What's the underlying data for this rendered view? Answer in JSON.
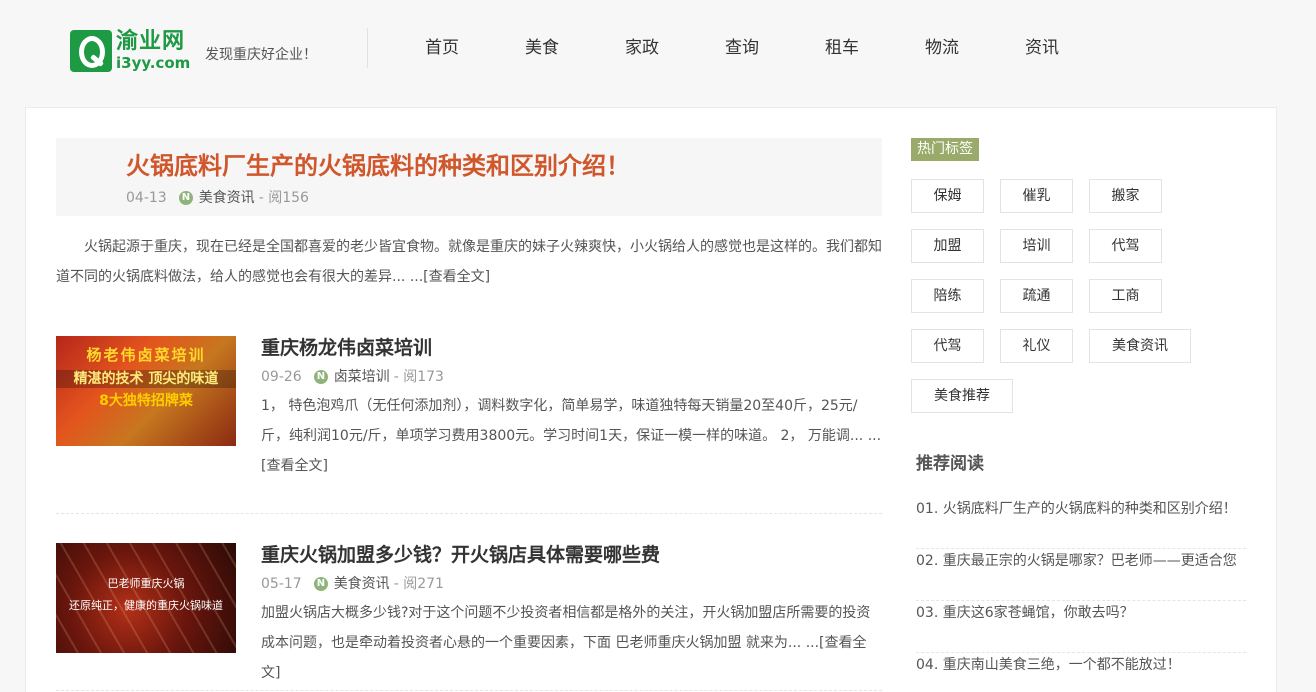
{
  "header": {
    "logo_name": "渝业网",
    "logo_domain": "i3yy.com",
    "slogan": "发现重庆好企业！",
    "nav": [
      "首页",
      "美食",
      "家政",
      "查询",
      "租车",
      "物流",
      "资讯"
    ]
  },
  "featured": {
    "title": "火锅底料厂生产的火锅底料的种类和区别介绍！",
    "date": "04-13",
    "category": "美食资讯",
    "views": "- 阅156",
    "excerpt": "火锅起源于重庆，现在已经是全国都喜爱的老少皆宜食物。就像是重庆的妹子火辣爽快，小火锅给人的感觉也是这样的。我们都知道不同的火锅底料做法，给人的感觉也会有很大的差异... ",
    "more": "...[查看全文]"
  },
  "posts": [
    {
      "title": "重庆杨龙伟卤菜培训",
      "date": "09-26",
      "category": "卤菜培训",
      "views": "- 阅173",
      "excerpt": "1， 特色泡鸡爪（无任何添加剂），调料数字化，简单易学，味道独特每天销量20至40斤，25元/斤，纯利润10元/斤，单项学习费用3800元。学习时间1天，保证一模一样的味道。 2， 万能调... ",
      "more": "...[查看全文]",
      "thumb_lines": [
        "杨老伟卤菜培训",
        "精湛的技术 顶尖的味道",
        "8大独特招牌菜"
      ]
    },
    {
      "title": "重庆火锅加盟多少钱？开火锅店具体需要哪些费",
      "date": "05-17",
      "category": "美食资讯",
      "views": "- 阅271",
      "excerpt": "加盟火锅店大概多少钱?对于这个问题不少投资者相信都是格外的关注，开火锅加盟店所需要的投资成本问题，也是牵动着投资者心悬的一个重要因素，下面 巴老师重庆火锅加盟 就来为... ",
      "more": "...[查看全文]",
      "thumb_lines": [
        "巴老师重庆火锅",
        "还原纯正，健康的重庆火锅味道"
      ]
    }
  ],
  "sidebar": {
    "hot_tags_label": "热门标签",
    "tags": [
      "保姆",
      "催乳",
      "搬家",
      "加盟",
      "培训",
      "代驾",
      "陪练",
      "疏通",
      "工商",
      "代驾",
      "礼仪",
      "美食资讯",
      "美食推荐"
    ],
    "recommend_title": "推荐阅读",
    "recommend": [
      "01. 火锅底料厂生产的火锅底料的种类和区别介绍！",
      "02. 重庆最正宗的火锅是哪家？巴老师——更适合您",
      "03. 重庆这6家苍蝇馆，你敢去吗？",
      "04. 重庆南山美食三绝，一个都不能放过！"
    ]
  },
  "colors": {
    "brand_green": "#1e9a45",
    "featured_title": "#d0572c",
    "tag_label_bg": "#9aaa6a"
  }
}
